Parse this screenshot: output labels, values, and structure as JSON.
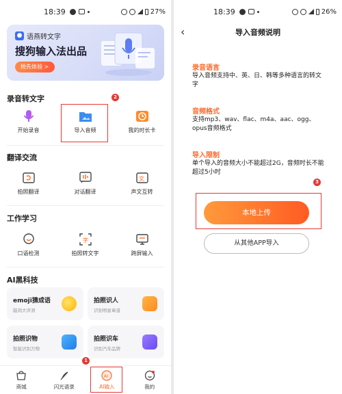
{
  "left": {
    "status": {
      "time": "18:39",
      "battery": "27%"
    },
    "banner": {
      "brand": "语燕转文字",
      "title": "搜狗输入法出品",
      "cta": "抢先体验 >"
    },
    "sections": {
      "recording": {
        "title": "录音转文字",
        "items": [
          "开始录音",
          "导入音频",
          "我的时长卡"
        ]
      },
      "translate": {
        "title": "翻译交流",
        "items": [
          "拍照翻译",
          "对话翻译",
          "声文互转"
        ]
      },
      "work": {
        "title": "工作学习",
        "items": [
          "口语检测",
          "拍照转文字",
          "跨屏输入"
        ]
      },
      "ai": {
        "title": "AI黑科技",
        "cards": [
          {
            "title": "emoji猜成语",
            "sub": "脑洞大评测"
          },
          {
            "title": "拍照识人",
            "sub": "识别明星章道"
          },
          {
            "title": "拍照识物",
            "sub": "智能识别万物"
          },
          {
            "title": "拍照识车",
            "sub": "识别汽车品牌"
          }
        ]
      }
    },
    "tabs": [
      "商城",
      "闪光语录",
      "AI输入",
      "我的"
    ],
    "badges": {
      "import": "2",
      "ai_tab": "1"
    }
  },
  "right": {
    "status": {
      "time": "18:39",
      "battery": "26%"
    },
    "title": "导入音频说明",
    "blocks": [
      {
        "heading": "录音语言",
        "body": "导入音频支持中、英、日、韩等多种语言的转文字"
      },
      {
        "heading": "音频格式",
        "body": "支持mp3、wav、flac、m4a、aac、ogg、opus音频格式"
      },
      {
        "heading": "导入限制",
        "body": "单个导入的音频大小不能超过2G，音频时长不能超过5小时"
      }
    ],
    "primary_button": "本地上传",
    "secondary_button": "从其他APP导入",
    "badge": "3"
  },
  "colors": {
    "accent": "#ff6a2a",
    "highlight": "#e53935",
    "blue": "#3d6cf0"
  }
}
